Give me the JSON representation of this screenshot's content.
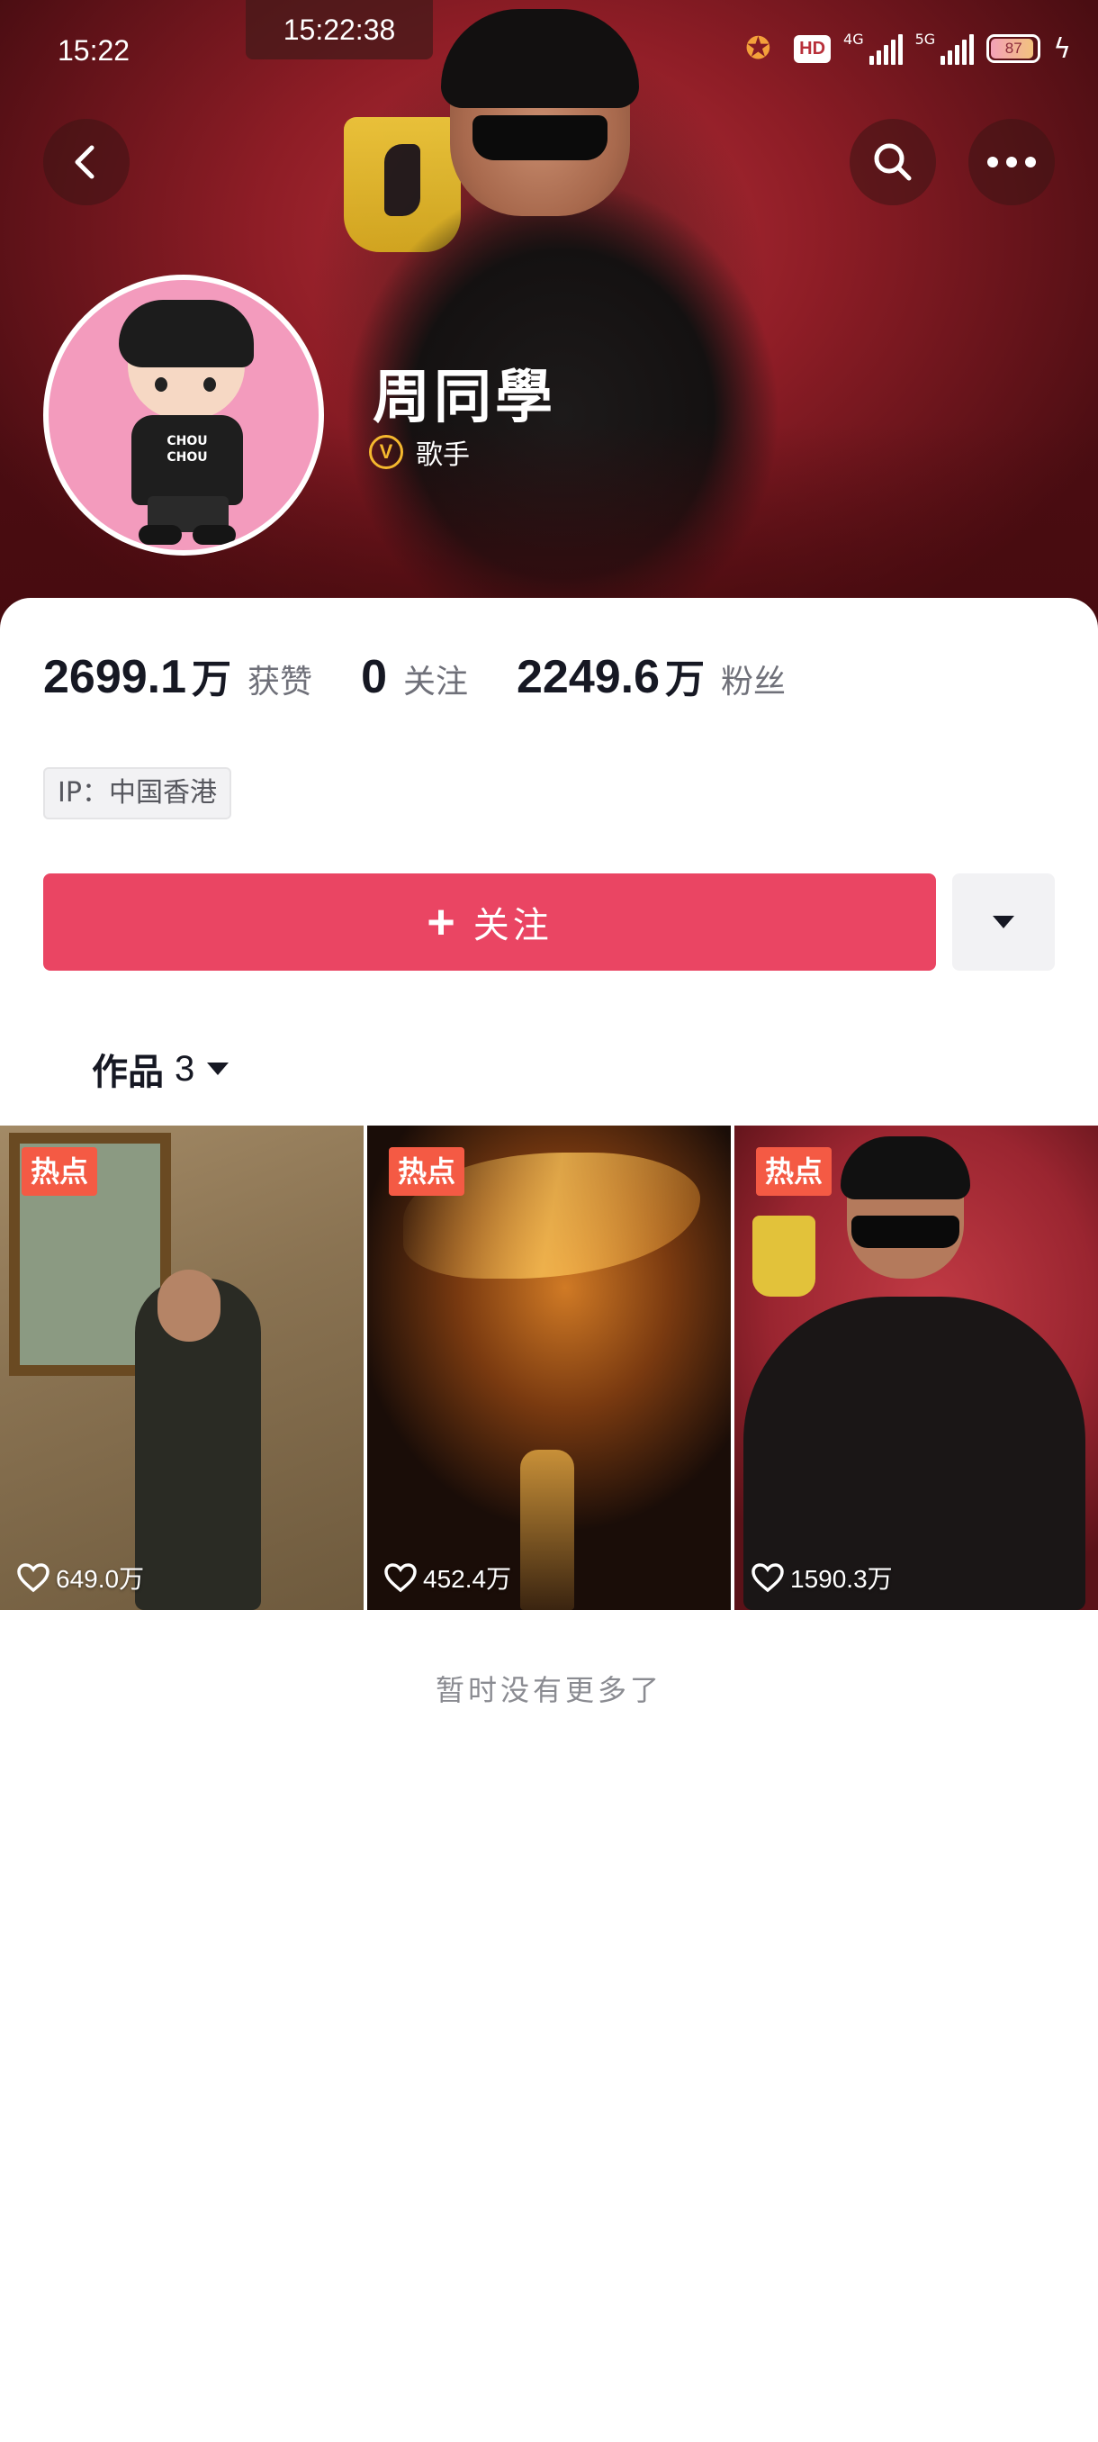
{
  "status_bar": {
    "time": "15:22",
    "clock_overlay": "15:22:38",
    "hd_label": "HD",
    "net_1": "4G",
    "net_2": "5G",
    "battery": "87"
  },
  "profile": {
    "name": "周同學",
    "verified_label": "歌手",
    "avatar_shirt_text": "CHOU CHOU"
  },
  "stats": [
    {
      "value": "2699.1",
      "unit": "万",
      "label": "获赞"
    },
    {
      "value": "0",
      "unit": "",
      "label": "关注"
    },
    {
      "value": "2249.6",
      "unit": "万",
      "label": "粉丝"
    }
  ],
  "ip_tag": "IP：中国香港",
  "actions": {
    "follow_label": "关注"
  },
  "works": {
    "tab_label": "作品",
    "count": "3"
  },
  "videos": [
    {
      "tag": "热点",
      "likes": "649.0万"
    },
    {
      "tag": "热点",
      "likes": "452.4万"
    },
    {
      "tag": "热点",
      "likes": "1590.3万"
    }
  ],
  "end_message": "暂时没有更多了",
  "colors": {
    "accent": "#ea4563",
    "hot_tag": "#f45a44",
    "verify": "#f5b82e"
  }
}
